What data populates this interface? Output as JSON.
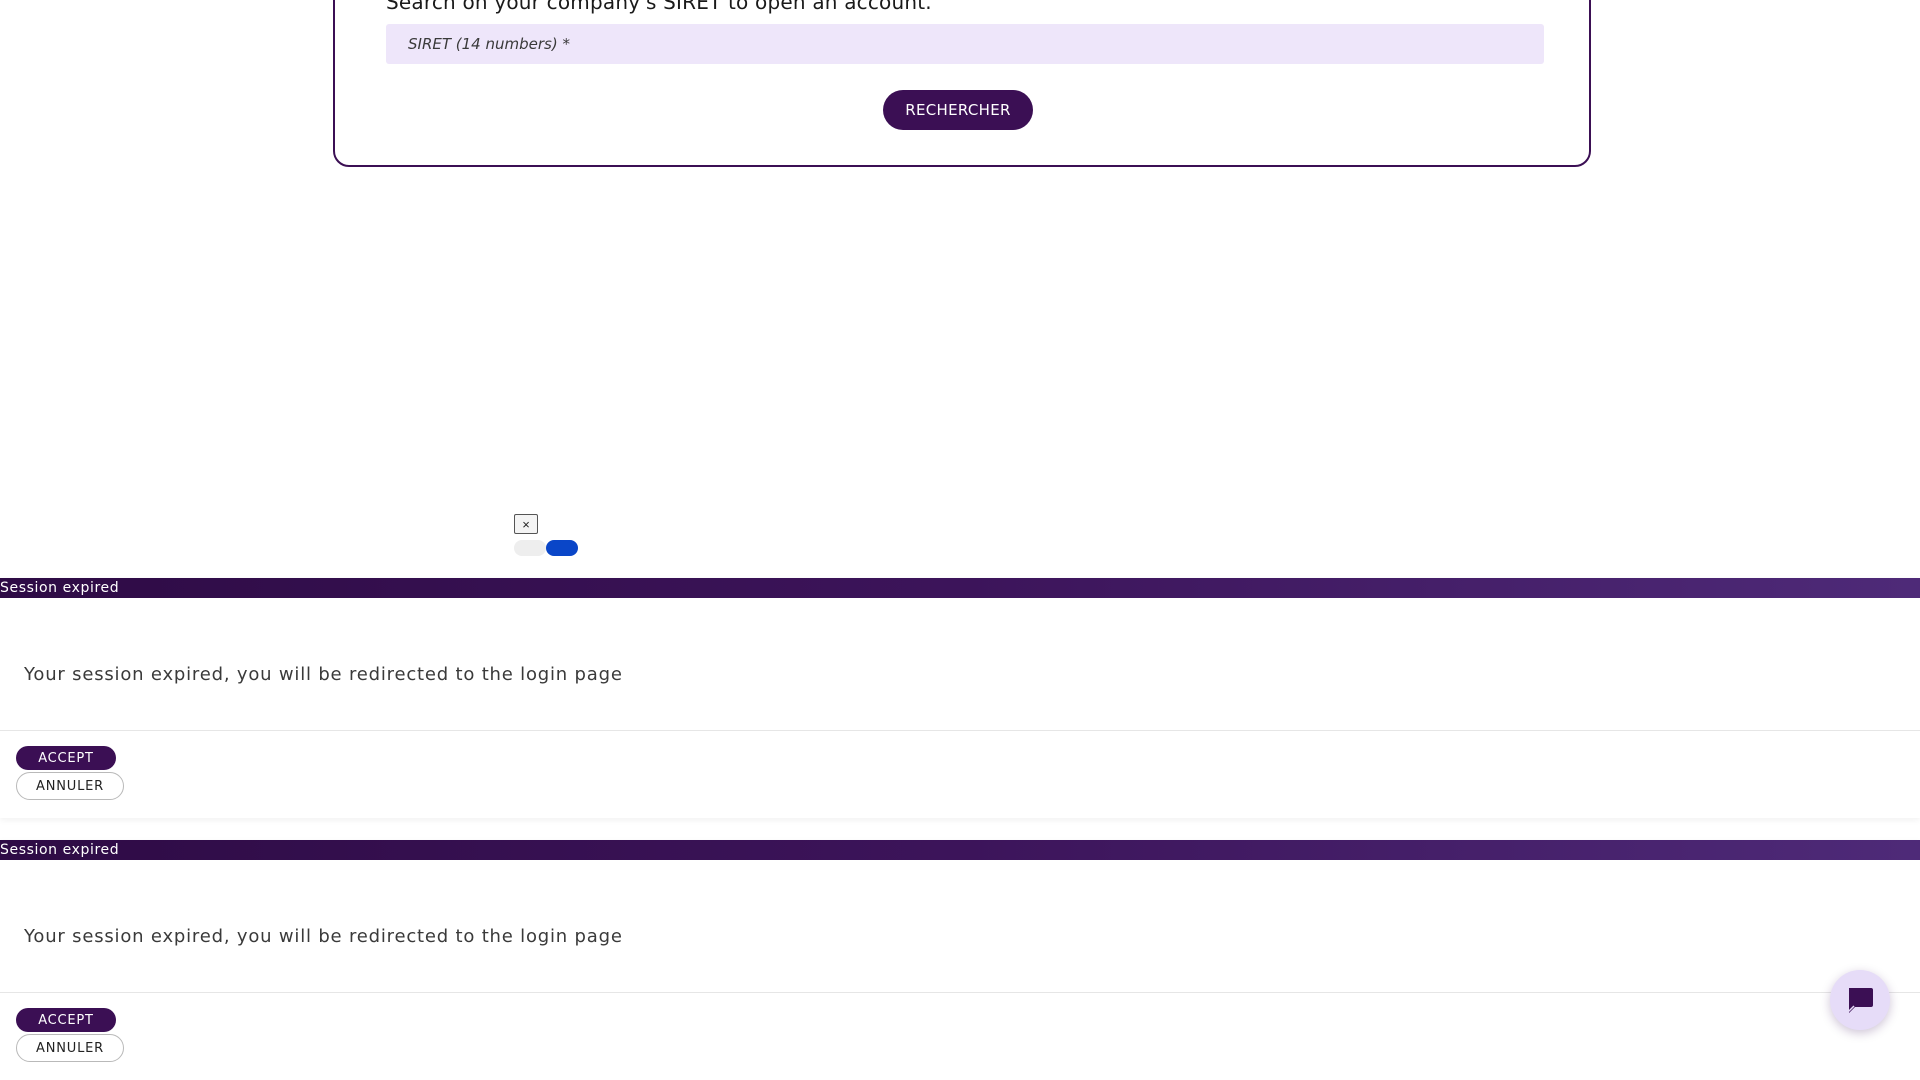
{
  "search": {
    "title": "Search on your company's SIRET to open an account.",
    "placeholder": "SIRET (14 numbers) *",
    "value": "",
    "button_label": "RECHERCHER"
  },
  "widget": {
    "close_symbol": "×",
    "toggle_icon": "toggle-switch-icon",
    "toggle_color": "#0a46c8"
  },
  "modals": [
    {
      "title": "Session expired",
      "message": "Your session expired, you will be redirected to the login page",
      "accept_label": "ACCEPT",
      "cancel_label": "ANNULER"
    },
    {
      "title": "Session expired",
      "message": "Your session expired, you will be redirected to the login page",
      "accept_label": "ACCEPT",
      "cancel_label": "ANNULER"
    }
  ],
  "chat": {
    "icon": "chat-bubble-icon"
  },
  "colors": {
    "brand": "#3b0f54",
    "input_background": "#eee6fa",
    "header_gradient_start": "#2e0b45",
    "header_gradient_end": "#4e2a78",
    "chat_background": "#e6dcf8"
  }
}
